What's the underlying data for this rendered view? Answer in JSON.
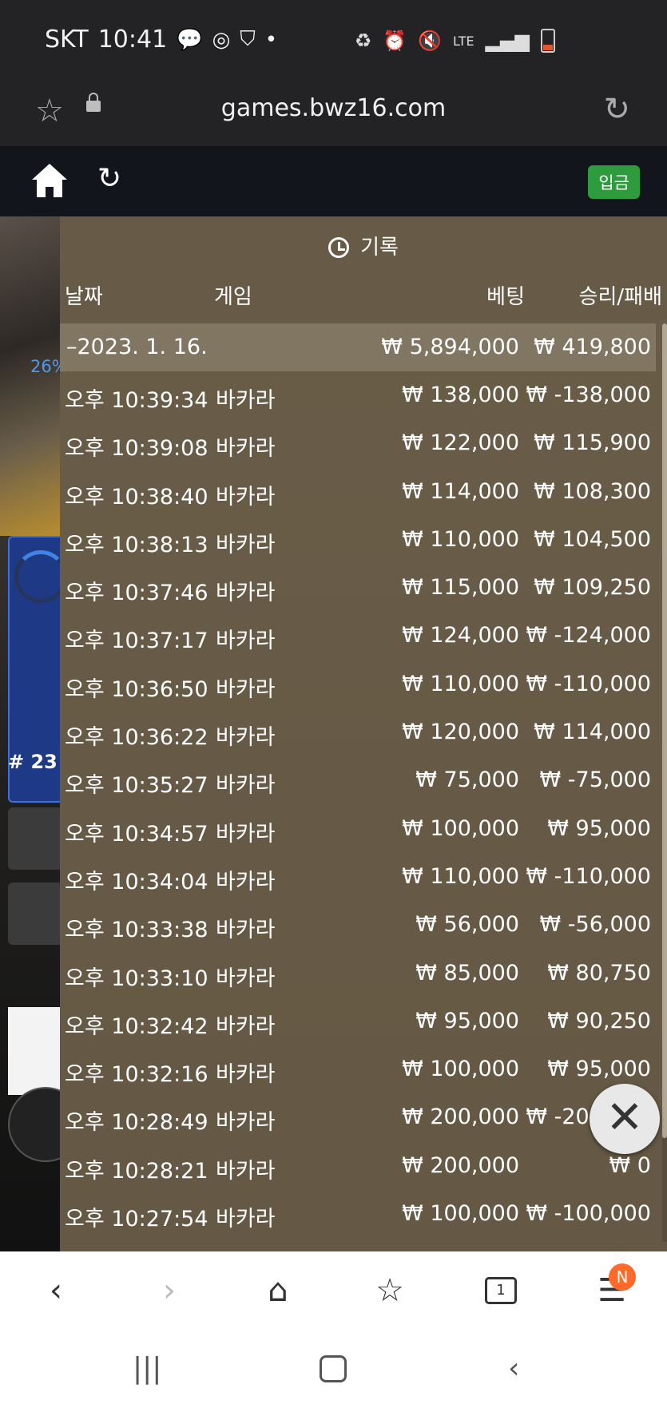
{
  "status_bar": {
    "carrier": "SKT",
    "time": "10:41",
    "network": "LTE"
  },
  "browser": {
    "url": "games.bwz16.com"
  },
  "game_header": {
    "deposit_label": "입금"
  },
  "background": {
    "progress_percent": "26%",
    "round_label": "# 23"
  },
  "history": {
    "title": "기록",
    "columns": {
      "date": "날짜",
      "game": "게임",
      "bet": "베팅",
      "result": "승리/패배"
    },
    "date_group": {
      "date": "–2023. 1. 16.",
      "bet_total": "₩ 5,894,000",
      "result_total": "₩ 419,800"
    },
    "rows": [
      {
        "time": "오후 10:39:34",
        "game": "바카라",
        "bet": "₩ 138,000",
        "result": "₩ -138,000"
      },
      {
        "time": "오후 10:39:08",
        "game": "바카라",
        "bet": "₩ 122,000",
        "result": "₩ 115,900"
      },
      {
        "time": "오후 10:38:40",
        "game": "바카라",
        "bet": "₩ 114,000",
        "result": "₩ 108,300"
      },
      {
        "time": "오후 10:38:13",
        "game": "바카라",
        "bet": "₩ 110,000",
        "result": "₩ 104,500"
      },
      {
        "time": "오후 10:37:46",
        "game": "바카라",
        "bet": "₩ 115,000",
        "result": "₩ 109,250"
      },
      {
        "time": "오후 10:37:17",
        "game": "바카라",
        "bet": "₩ 124,000",
        "result": "₩ -124,000"
      },
      {
        "time": "오후 10:36:50",
        "game": "바카라",
        "bet": "₩ 110,000",
        "result": "₩ -110,000"
      },
      {
        "time": "오후 10:36:22",
        "game": "바카라",
        "bet": "₩ 120,000",
        "result": "₩ 114,000"
      },
      {
        "time": "오후 10:35:27",
        "game": "바카라",
        "bet": "₩ 75,000",
        "result": "₩ -75,000"
      },
      {
        "time": "오후 10:34:57",
        "game": "바카라",
        "bet": "₩ 100,000",
        "result": "₩ 95,000"
      },
      {
        "time": "오후 10:34:04",
        "game": "바카라",
        "bet": "₩ 110,000",
        "result": "₩ -110,000"
      },
      {
        "time": "오후 10:33:38",
        "game": "바카라",
        "bet": "₩ 56,000",
        "result": "₩ -56,000"
      },
      {
        "time": "오후 10:33:10",
        "game": "바카라",
        "bet": "₩ 85,000",
        "result": "₩ 80,750"
      },
      {
        "time": "오후 10:32:42",
        "game": "바카라",
        "bet": "₩ 95,000",
        "result": "₩ 90,250"
      },
      {
        "time": "오후 10:32:16",
        "game": "바카라",
        "bet": "₩ 100,000",
        "result": "₩ 95,000"
      },
      {
        "time": "오후 10:28:49",
        "game": "바카라",
        "bet": "₩ 200,000",
        "result": "₩ -200,000"
      },
      {
        "time": "오후 10:28:21",
        "game": "바카라",
        "bet": "₩ 200,000",
        "result": "₩ 0"
      },
      {
        "time": "오후 10:27:54",
        "game": "바카라",
        "bet": "₩ 100,000",
        "result": "₩ -100,000"
      }
    ]
  },
  "nav": {
    "tabs_count": "1",
    "notification_badge": "N"
  },
  "colors": {
    "panel": "#6c604a",
    "deposit": "#2e9b3c",
    "badge": "#ff6a2a"
  }
}
